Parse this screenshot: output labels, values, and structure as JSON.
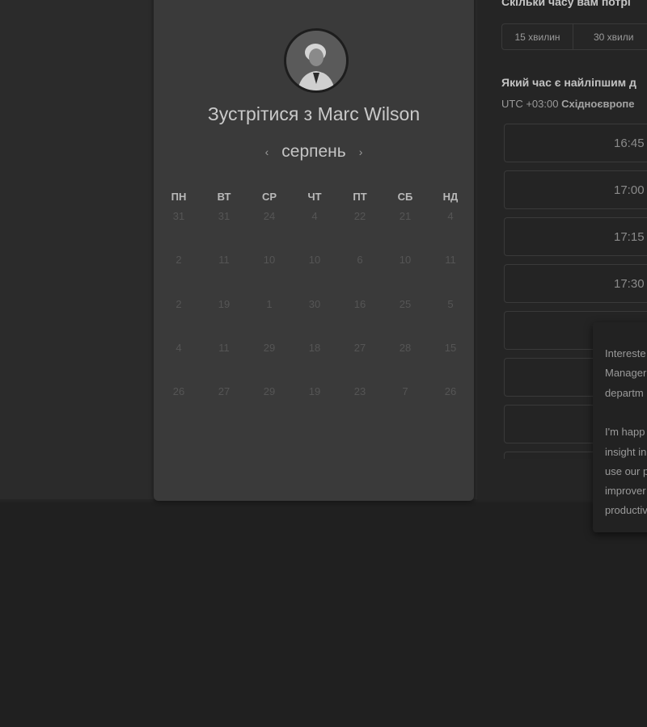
{
  "header": {
    "title": "Зустрітися з Marc Wilson"
  },
  "calendar": {
    "month": "серпень",
    "prev_icon": "chevron-left-icon",
    "next_icon": "chevron-right-icon",
    "weekdays": [
      "ПН",
      "ВТ",
      "СР",
      "ЧТ",
      "ПТ",
      "СБ",
      "НД"
    ],
    "weeks": [
      [
        "31",
        "31",
        "24",
        "4",
        "22",
        "21",
        "4"
      ],
      [
        "2",
        "11",
        "10",
        "10",
        "6",
        "10",
        "11"
      ],
      [
        "2",
        "19",
        "1",
        "30",
        "16",
        "25",
        "5"
      ],
      [
        "4",
        "11",
        "29",
        "18",
        "27",
        "28",
        "15"
      ],
      [
        "26",
        "27",
        "29",
        "19",
        "23",
        "7",
        "26"
      ]
    ]
  },
  "duration": {
    "question": "Скільки часу вам потрі",
    "options": [
      "15 хвилин",
      "30 хвили"
    ]
  },
  "time": {
    "question": "Який час є найліпшим д",
    "timezone_prefix": "UTC +03:00",
    "timezone_name": "Східноєвропе",
    "slots": [
      "16:45",
      "17:00",
      "17:15",
      "17:30",
      "",
      "",
      "",
      ""
    ]
  },
  "popover": {
    "lines": [
      "Intereste",
      "Manager",
      "departm",
      "",
      "I'm happ",
      "insight in",
      "use our p",
      "improver",
      "productiv"
    ]
  }
}
